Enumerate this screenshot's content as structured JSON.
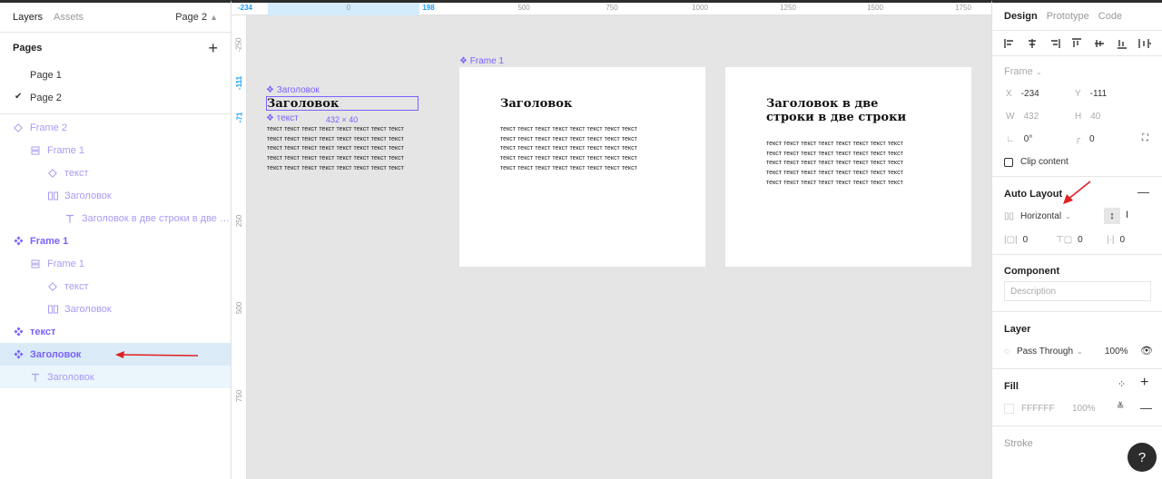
{
  "left_panel": {
    "tabs": [
      "Layers",
      "Assets"
    ],
    "current_page": "Page 2",
    "pages_title": "Pages",
    "pages": [
      {
        "name": "Page 1",
        "checked": false
      },
      {
        "name": "Page 2",
        "checked": true
      }
    ],
    "layers": [
      {
        "name": "Frame 2",
        "indent": 0,
        "icon": "diamond-outline-icon",
        "style": "dim"
      },
      {
        "name": "Frame 1",
        "indent": 1,
        "icon": "rows-icon",
        "style": "dim"
      },
      {
        "name": "текст",
        "indent": 2,
        "icon": "diamond-outline-icon",
        "style": "dim"
      },
      {
        "name": "Заголовок",
        "indent": 2,
        "icon": "columns-icon",
        "style": "dim"
      },
      {
        "name": "Заголовок в две строки в две стро...",
        "indent": 3,
        "icon": "text-icon",
        "style": "dim"
      },
      {
        "name": "Frame 1",
        "indent": 0,
        "icon": "component-icon",
        "style": "bold"
      },
      {
        "name": "Frame 1",
        "indent": 1,
        "icon": "rows-icon",
        "style": "dim"
      },
      {
        "name": "текст",
        "indent": 2,
        "icon": "diamond-outline-icon",
        "style": "dim"
      },
      {
        "name": "Заголовок",
        "indent": 2,
        "icon": "columns-icon",
        "style": "dim"
      },
      {
        "name": "текст",
        "indent": 0,
        "icon": "component-icon",
        "style": "bold"
      },
      {
        "name": "Заголовок",
        "indent": 0,
        "icon": "component-icon",
        "style": "bold-selected"
      },
      {
        "name": "Заголовок",
        "indent": 1,
        "icon": "text-icon",
        "style": "sub-selected"
      }
    ]
  },
  "ruler_top": {
    "ticks": [
      {
        "label": "-234",
        "sel": true
      },
      {
        "label": "0",
        "sel": false
      },
      {
        "label": "198",
        "sel": true
      },
      {
        "label": "500",
        "sel": false
      },
      {
        "label": "750",
        "sel": false
      },
      {
        "label": "1000",
        "sel": false
      },
      {
        "label": "1250",
        "sel": false
      },
      {
        "label": "1500",
        "sel": false
      },
      {
        "label": "1750",
        "sel": false
      }
    ]
  },
  "ruler_left": {
    "ticks": [
      {
        "label": "-250",
        "sel": false
      },
      {
        "label": "-111",
        "sel": true
      },
      {
        "label": "-71",
        "sel": true
      },
      {
        "label": "250",
        "sel": false
      },
      {
        "label": "500",
        "sel": false
      },
      {
        "label": "750",
        "sel": false
      }
    ]
  },
  "canvas": {
    "component_heading_label": "Заголовок",
    "component_heading_text": "Заголовок",
    "component_text_label": "текст",
    "selection_size": "432 × 40",
    "body_lines": "текст текст текст текст текст текст текст текст\nтекст текст текст текст текст текст текст текст\nтекст текст текст текст текст текст текст текст\nтекст текст текст текст текст текст текст текст\nтекст текст текст текст текст текст текст текст",
    "frame1_label": "Frame 1",
    "frame1_heading": "Заголовок",
    "frame2_heading": "Заголовок в две\nстроки в две строки"
  },
  "right_panel": {
    "tabs": [
      "Design",
      "Prototype",
      "Code"
    ],
    "frame_title": "Frame",
    "x": {
      "k": "X",
      "v": "-234"
    },
    "y": {
      "k": "Y",
      "v": "-111"
    },
    "w": {
      "k": "W",
      "v": "432"
    },
    "h": {
      "k": "H",
      "v": "40"
    },
    "rotation": "0°",
    "radius": "0",
    "clip_content": "Clip content",
    "auto_layout_title": "Auto Layout",
    "direction": "Horizontal",
    "padding_h": "0",
    "padding_v": "0",
    "spacing": "0",
    "component_title": "Component",
    "description_placeholder": "Description",
    "layer_title": "Layer",
    "blend_mode": "Pass Through",
    "opacity": "100%",
    "fill_title": "Fill",
    "fill_hex": "FFFFFF",
    "fill_opacity": "100%",
    "stroke_title": "Stroke",
    "help": "?"
  },
  "colors": {
    "accent": "#7b61ff",
    "ruler_selected": "#18a0fb",
    "selected_row": "#daebf7",
    "annotation_arrow": "#e02020"
  }
}
